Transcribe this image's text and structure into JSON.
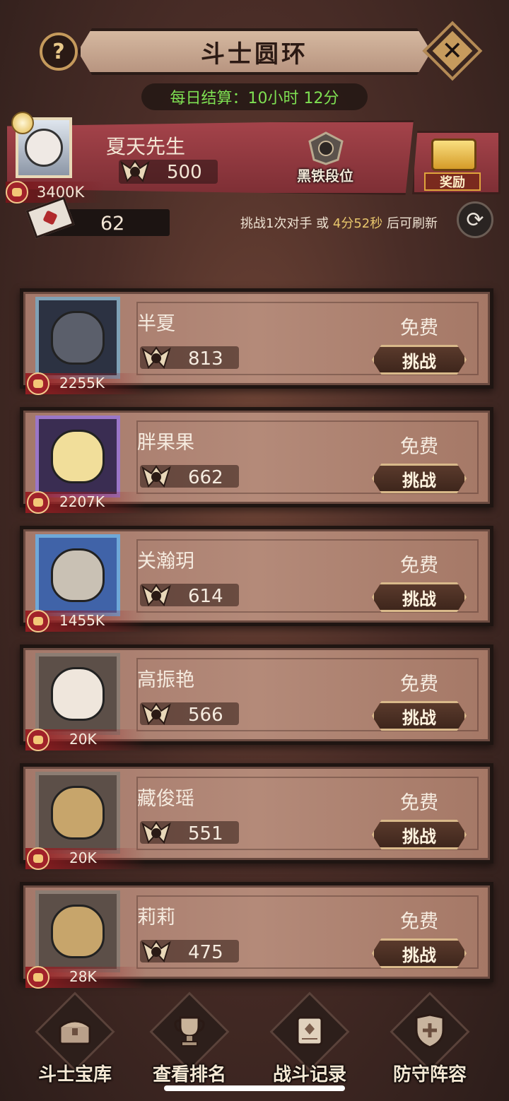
{
  "header": {
    "title": "斗士圆环",
    "help_icon": "?",
    "close_icon": "✕",
    "settlement_label": "每日结算：",
    "settlement_time": "10小时 12分"
  },
  "player": {
    "name": "夏天先生",
    "points": "500",
    "power": "3400K",
    "rank_label": "黑铁段位",
    "reward_label": "奖励"
  },
  "tickets": {
    "count": "62",
    "refresh_prefix": "挑战1次对手 或 ",
    "refresh_time": "4分52秒",
    "refresh_suffix": " 后可刷新"
  },
  "opponents": [
    {
      "name": "半夏",
      "points": "813",
      "power": "2255K",
      "cost": "免费",
      "action": "挑战"
    },
    {
      "name": "胖果果",
      "points": "662",
      "power": "2207K",
      "cost": "免费",
      "action": "挑战"
    },
    {
      "name": "关瀚玥",
      "points": "614",
      "power": "1455K",
      "cost": "免费",
      "action": "挑战"
    },
    {
      "name": "高振艳",
      "points": "566",
      "power": "20K",
      "cost": "免费",
      "action": "挑战"
    },
    {
      "name": "藏俊瑶",
      "points": "551",
      "power": "20K",
      "cost": "免费",
      "action": "挑战"
    },
    {
      "name": "莉莉",
      "points": "475",
      "power": "28K",
      "cost": "免费",
      "action": "挑战"
    }
  ],
  "nav": [
    {
      "label": "斗士宝库",
      "icon": "treasure-chest-icon"
    },
    {
      "label": "查看排名",
      "icon": "trophy-icon"
    },
    {
      "label": "战斗记录",
      "icon": "scroll-icon"
    },
    {
      "label": "防守阵容",
      "icon": "shield-icon"
    }
  ],
  "colors": {
    "accent_green": "#7ee052",
    "banner_red": "#a4434a",
    "gold": "#d9b98a"
  }
}
